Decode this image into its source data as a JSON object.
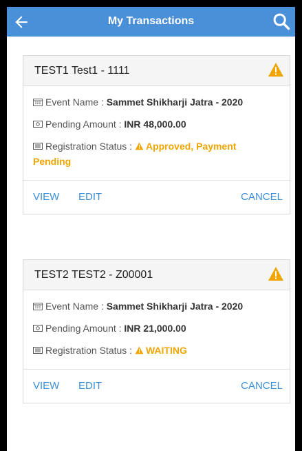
{
  "header": {
    "title": "My Transactions"
  },
  "cards": [
    {
      "title": "TEST1 Test1 - 1111",
      "event_label": "Event Name : ",
      "event_value": "Sammet Shikharji Jatra - 2020",
      "amount_label": "Pending Amount : ",
      "amount_value": "INR 48,000.00",
      "status_label": "Registration Status : ",
      "status_value_1": "Approved, Payment",
      "status_value_2": "Pending",
      "actions": {
        "view": "VIEW",
        "edit": "EDIT",
        "cancel": "CANCEL"
      }
    },
    {
      "title": "TEST2 TEST2 - Z00001",
      "event_label": "Event Name : ",
      "event_value": "Sammet Shikharji Jatra - 2020",
      "amount_label": "Pending Amount : ",
      "amount_value": "INR 21,000.00",
      "status_label": "Registration Status : ",
      "status_value": "WAITING",
      "actions": {
        "view": "VIEW",
        "edit": "EDIT",
        "cancel": "CANCEL"
      }
    }
  ],
  "colors": {
    "header": "#4a90d9",
    "link": "#3a8ed8",
    "warning": "#f0a500"
  },
  "icons": [
    "back-arrow-icon",
    "search-icon",
    "warning-icon",
    "calendar-icon",
    "money-icon",
    "list-icon"
  ]
}
